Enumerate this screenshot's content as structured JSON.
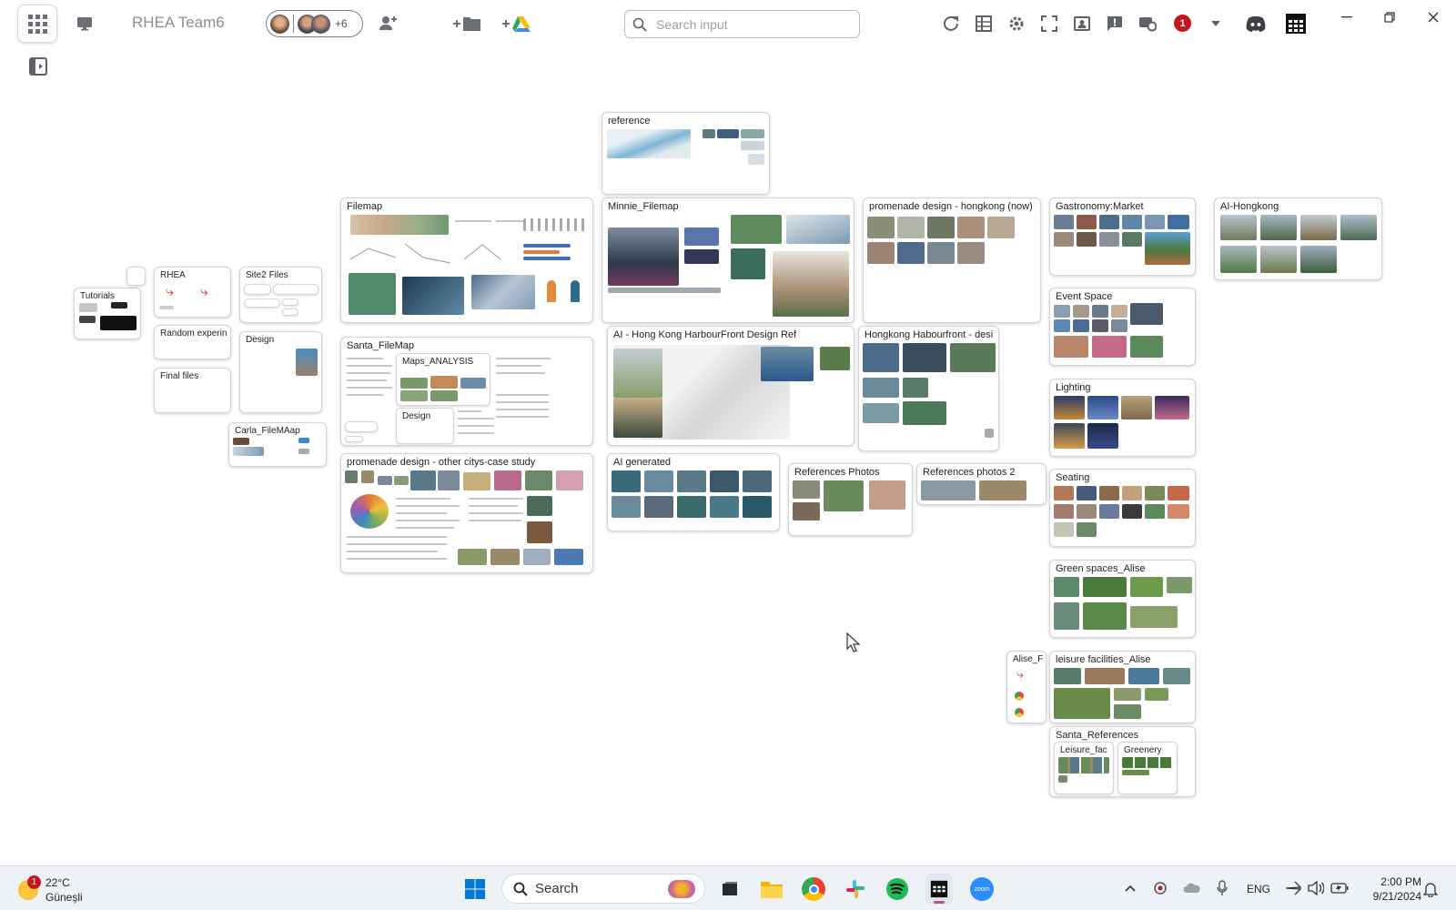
{
  "toolbar": {
    "team_name": "RHEA Team6",
    "collaborators_extra": "+6",
    "search_placeholder": "Search input",
    "notification_count": "1"
  },
  "boards": {
    "reference": "reference",
    "filemap": "Filemap",
    "minnie_filemap": "Minnie_Filemap",
    "promenade_hk": "promenade design - hongkong (now)",
    "gastronomy": "Gastronomy:Market",
    "ai_hongkong": "AI-Hongkong",
    "tutorials": "Tutorials",
    "rhea": "RHEA",
    "site2": "Site2 Files",
    "random": "Random experin",
    "design_small": "Design",
    "final_files": "Final files",
    "carla": "Carla_FileMAap",
    "santa_filemap": "Santa_FileMap",
    "maps_analysis": "Maps_ANALYSIS",
    "santa_design": "Design",
    "ai_harbourfront": "AI - Hong Kong HarbourFront Design Ref",
    "hk_habourfront": "Hongkong Habourfront - desi",
    "event_space": "Event Space",
    "lighting": "Lighting",
    "promenade_other": "promenade design - other citys-case study",
    "ai_generated": "AI generated",
    "ref_photos": "References Photos",
    "ref_photos2": "References photos 2",
    "seating": "Seating",
    "green_spaces": "Green spaces_Alise",
    "alise_f": "Alise_F",
    "leisure": "leisure facilities_Alise",
    "santa_refs": "Santa_References",
    "leisure_fac": "Leisure_fac",
    "greenery": "Greenery"
  },
  "taskbar": {
    "weather_temp": "22°C",
    "weather_desc": "Güneşli",
    "weather_badge": "1",
    "search_label": "Search",
    "language": "ENG",
    "time": "2:00 PM",
    "date": "9/21/2024"
  },
  "colors": {
    "accent_red": "#c4161c",
    "discord": "#5865f2",
    "spotify": "#1db954",
    "zoom": "#2d8cff",
    "windows_blue": "#0078d4"
  }
}
